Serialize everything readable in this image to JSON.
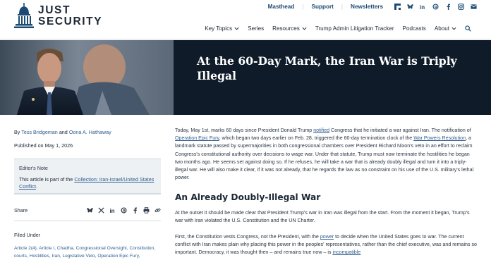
{
  "brand": {
    "line1": "JUST",
    "line2": "SECURITY",
    "color": "#1c2733"
  },
  "toplinks": [
    {
      "label": "Masthead"
    },
    {
      "label": "Support"
    },
    {
      "label": "Newsletters"
    }
  ],
  "socials": [
    "flipboard-icon",
    "bluesky-icon",
    "linkedin-icon",
    "threads-icon",
    "facebook-icon",
    "instagram-icon",
    "email-icon"
  ],
  "nav": [
    {
      "label": "Key Topics",
      "dropdown": true
    },
    {
      "label": "Series",
      "dropdown": false
    },
    {
      "label": "Resources",
      "dropdown": true
    },
    {
      "label": "Trump Admin Litigation Tracker",
      "dropdown": false
    },
    {
      "label": "Podcasts",
      "dropdown": false
    },
    {
      "label": "About",
      "dropdown": true
    }
  ],
  "hero": {
    "title": "At the 60-Day Mark, the Iran War is Triply Illegal",
    "background": "#0f1b29"
  },
  "byline": {
    "prefix": "By",
    "author1": "Tess Bridgeman",
    "and": "and",
    "author2": "Oona A. Hathaway"
  },
  "published": "Published on May 1, 2026",
  "editors_note": {
    "label": "Editor's Note",
    "text_prefix": "This article is part of the",
    "link": "Collection: Iran-Israel/United States Conflict",
    "text_suffix": "."
  },
  "share": {
    "label": "Share",
    "icons": [
      "bluesky-icon",
      "x-icon",
      "linkedin-icon",
      "threads-icon",
      "facebook-icon",
      "print-icon",
      "link-icon"
    ]
  },
  "filed_under": {
    "label": "Filed Under",
    "tags": "Article 2(4), Article I, Chadha, Congressional Oversight, Constitution, courts, Hostilities, Iran, Legislative Veto, Operation Epic Fury,"
  },
  "article": {
    "p1": {
      "a": "Today, May 1st, marks 60 days since President Donald Trump ",
      "l1": "notified",
      "b": " Congress that he initiated a war against Iran. The notification of ",
      "l2": "Operation Epic Fury",
      "c": ", which began two days earlier on Feb. 28, triggered the 60-day termination clock of the ",
      "l3": "War Powers Resolution",
      "d": ", a landmark statute passed by supermajorities in both congressional chambers over President Richard Nixon's veto in an effort to reclaim Congress's constitutional authority over decisions to wage war. Under that statute, Trump must now terminate the hostilities he began two months ago. He seems set against doing so. If he refuses, he will take a war that is already doubly illegal and turn it into a triply-illegal war.  He will also make it clear, if it was not already, that he regards the law as no constraint on his use of the U.S. military's lethal power."
    },
    "h2": "An Already Doubly-Illegal War",
    "p2": "At the outset it should be made clear that President Trump's war in Iran was illegal from the start. From the moment it began, Trump's war with Iran violated the U.S. Constitution and the UN Charter.",
    "p3": {
      "a": "First, the Constitution vests Congress, not the President, with the ",
      "l1": "power",
      "b": " to decide when the United States goes to war. The current conflict with Iran makes plain why placing this power in the peoples' representatives, rather than the chief executive, was and remains so important. Democracy, it was thought then – and remains true now – is ",
      "l2": "incompatible"
    }
  }
}
